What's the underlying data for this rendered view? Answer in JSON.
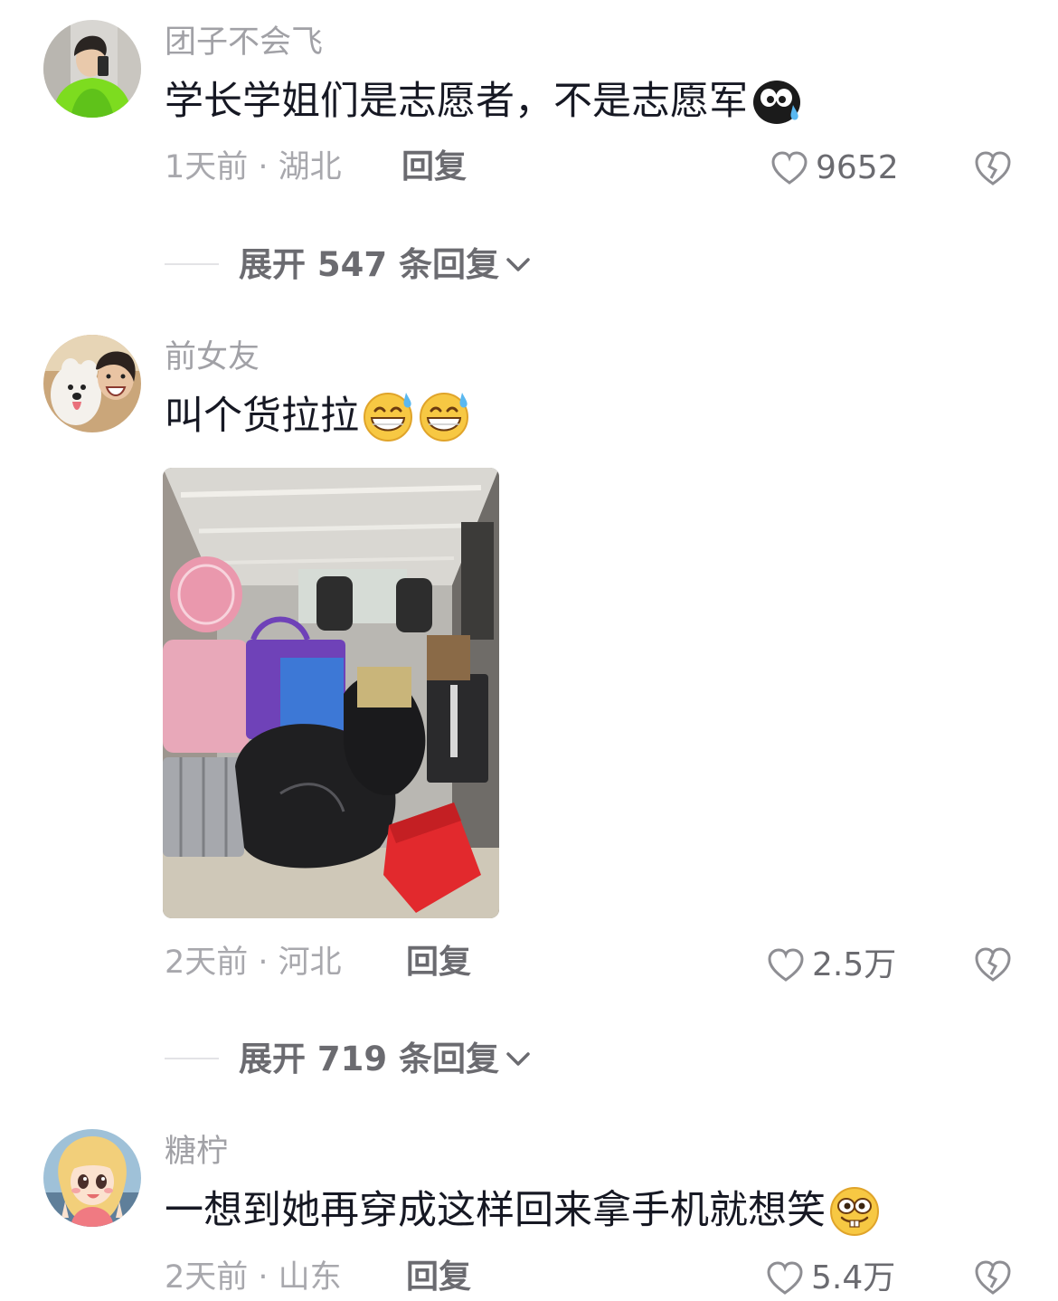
{
  "comments": [
    {
      "username": "团子不会飞",
      "text": "学长学姐们是志愿者，不是志愿军",
      "emoji_names": [
        "crying-blob-emoji"
      ],
      "time_location": "1天前 · 湖北",
      "reply_label": "回复",
      "like_count": "9652",
      "expand_label": "展开 547 条回复"
    },
    {
      "username": "前女友",
      "text": "叫个货拉拉",
      "emoji_names": [
        "sweat-grin-emoji",
        "sweat-grin-emoji"
      ],
      "time_location": "2天前 · 河北",
      "reply_label": "回复",
      "like_count": "2.5万",
      "expand_label": "展开 719 条回复",
      "image": "van-with-luggage-photo"
    },
    {
      "username": "糖柠",
      "text": "一想到她再穿成这样回来拿手机就想笑",
      "emoji_names": [
        "silly-buck-teeth-emoji"
      ],
      "time_location": "2天前 · 山东",
      "reply_label": "回复",
      "like_count": "5.4万"
    }
  ],
  "icons": {
    "like": "heart-outline-icon",
    "dislike": "broken-heart-icon",
    "expand": "chevron-down-icon"
  },
  "colors": {
    "text_primary": "#161823",
    "text_secondary": "#a1a1a6",
    "action_gray": "#6b6b70"
  }
}
